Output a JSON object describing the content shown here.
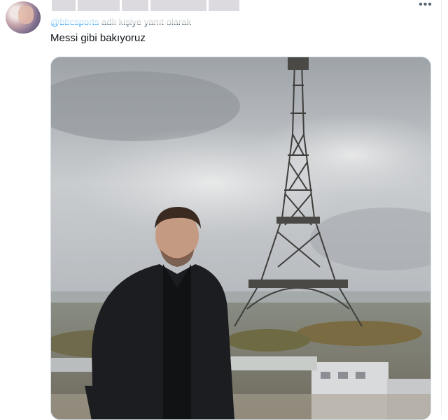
{
  "tweet": {
    "reply_handle": "@bbcsports",
    "reply_suffix": " adlı kişiye yanıt olarak",
    "text": "Messi gibi bakıyoruz",
    "more_label": "•••"
  },
  "colors": {
    "link": "#1d9bf0",
    "secondary_text": "#536471",
    "primary_text": "#0f1419",
    "border": "#cfd9de"
  },
  "icons": {
    "more": "more-horizontal-icon"
  }
}
